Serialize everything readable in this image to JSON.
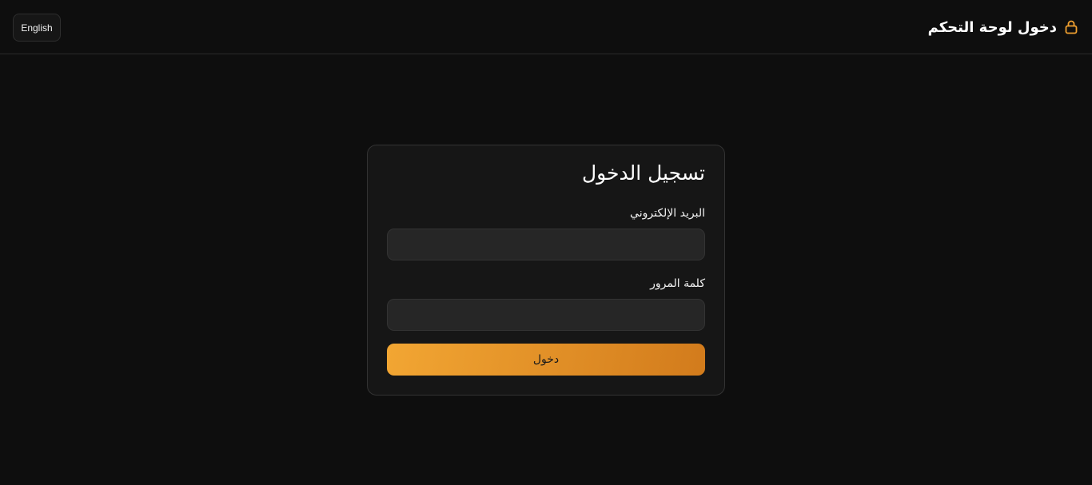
{
  "header": {
    "language_toggle": "English",
    "title": "دخول لوحة التحكم",
    "icon": "lock-icon"
  },
  "login": {
    "title": "تسجيل الدخول",
    "email_label": "البريد الإلكتروني",
    "email_value": "",
    "password_label": "كلمة المرور",
    "password_value": "",
    "submit_label": "دخول"
  },
  "colors": {
    "background": "#0e0e0e",
    "card": "#161616",
    "input": "#262626",
    "accent_start": "#f2a633",
    "accent_end": "#d27b1c",
    "icon_accent": "#f0a030"
  }
}
